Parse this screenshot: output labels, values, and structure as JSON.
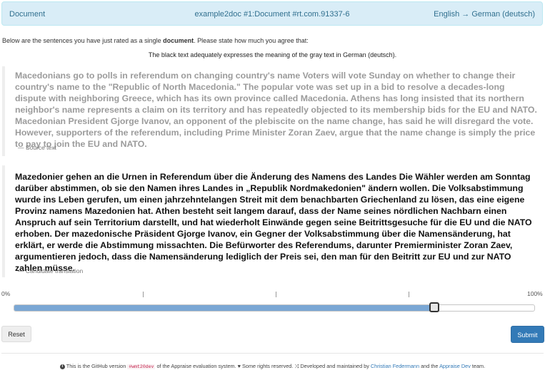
{
  "header": {
    "left": "Document",
    "center": "example2doc #1:Document #rt.com.91337-6",
    "right": "English → German (deutsch)"
  },
  "intro": {
    "before": "Below are the sentences you have just rated as a single ",
    "bold": "document",
    "after": ". Please state how much you agree that:"
  },
  "instruction": "The black text adequately expresses the meaning of the gray text in German (deutsch).",
  "source": {
    "text": "Macedonians go to polls in referendum on changing country's name Voters will vote Sunday on whether to change their country's name to the \"Republic of North Macedonia.\" The popular vote was set up in a bid to resolve a decades-long dispute with neighboring Greece, which has its own province called Macedonia. Athens has long insisted that its northern neighbor's name represents a claim on its territory and has repeatedly objected to its membership bids for the EU and NATO. Macedonian President Gjorge Ivanov, an opponent of the plebiscite on the name change, has said he will disregard the vote. However, supporters of the referendum, including Prime Minister Zoran Zaev, argue that the name change is simply the price to pay to join the EU and NATO.",
    "caption": "— Source text"
  },
  "candidate": {
    "text": "Mazedonier gehen an die Urnen in Referendum über die Änderung des Namens des Landes Die Wähler werden am Sonntag darüber abstimmen, ob sie den Namen ihres Landes in „Republik Nordmakedonien\" ändern wollen. Die Volksabstimmung wurde ins Leben gerufen, um einen jahrzehntelangen Streit mit dem benachbarten Griechenland zu lösen, das eine eigene Provinz namens Mazedonien hat. Athen besteht seit langem darauf, dass der Name seines nördlichen Nachbarn einen Anspruch auf sein Territorium darstellt, und hat wiederholt Einwände gegen seine Beitrittsgesuche für die EU und die NATO erhoben. Der mazedonische Präsident Gjorge Ivanov, ein Gegner der Volksabstimmung über die Namensänderung, hat erklärt, er werde die Abstimmung missachten. Die Befürworter des Referendums, darunter Premierminister Zoran Zaev, argumentieren jedoch, dass die Namensänderung lediglich der Preis sei, den man für den Beitritt zur EU und zur NATO zahlen müsse.",
    "caption": "— Candidate translation"
  },
  "slider": {
    "min_label": "0%",
    "max_label": "100%",
    "value_fraction": 0.808,
    "fill_color": "#7aa7d4"
  },
  "buttons": {
    "reset": "Reset",
    "submit": "Submit"
  },
  "footer": {
    "info_icon": "info-circle-icon",
    "t1": "This is the GitHub version",
    "code": "#wmt20dev",
    "t2": "of the Appraise evaluation system.",
    "heart_icon": "heart-icon",
    "t3": "Some rights reserved.",
    "random_icon": "random-icon",
    "t4": "Developed and maintained by",
    "link1": "Christian Federmann",
    "t5": "and the",
    "link2": "Appraise Dev",
    "t6": "team."
  }
}
